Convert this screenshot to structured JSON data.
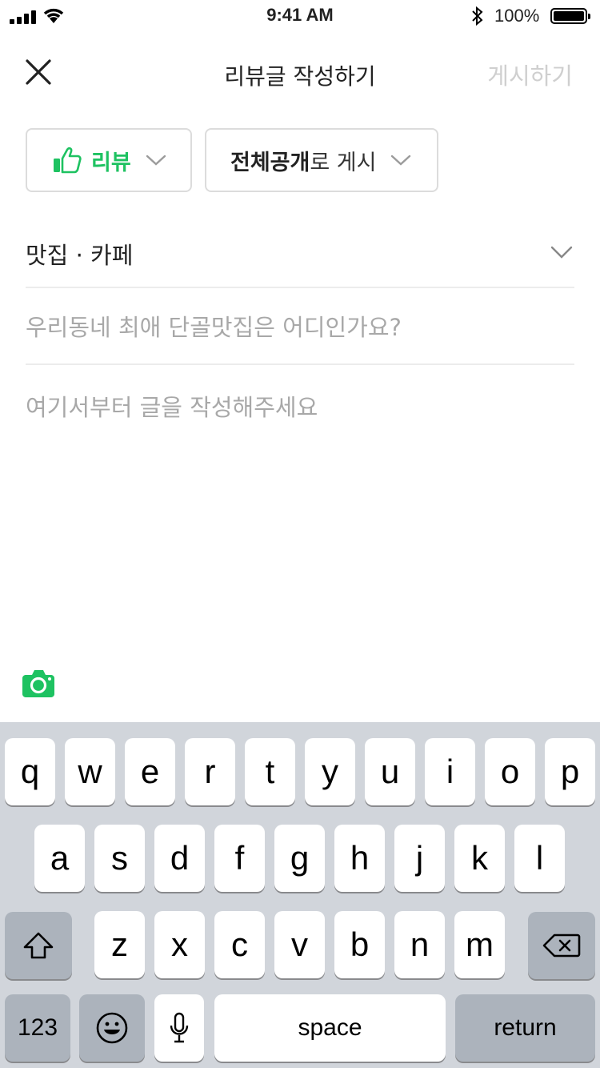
{
  "status_bar": {
    "time": "9:41 AM",
    "battery": "100%"
  },
  "nav": {
    "title": "리뷰글 작성하기",
    "post_label": "게시하기"
  },
  "type_dropdown": {
    "label": "리뷰"
  },
  "visibility_dropdown": {
    "bold": "전체공개",
    "rest": "로 게시"
  },
  "category": {
    "value": "맛집 · 카페"
  },
  "title_field": {
    "placeholder": "우리동네 최애 단골맛집은 어디인가요?"
  },
  "body_field": {
    "placeholder": "여기서부터 글을 작성해주세요"
  },
  "colors": {
    "accent": "#1ec261",
    "keyboard_bg": "#d1d5db",
    "key_dark": "#acb3bc"
  },
  "keyboard": {
    "row1": [
      "q",
      "w",
      "e",
      "r",
      "t",
      "y",
      "u",
      "i",
      "o",
      "p"
    ],
    "row2": [
      "a",
      "s",
      "d",
      "f",
      "g",
      "h",
      "j",
      "k",
      "l"
    ],
    "row3": [
      "z",
      "x",
      "c",
      "v",
      "b",
      "n",
      "m"
    ],
    "numbers_label": "123",
    "space_label": "space",
    "return_label": "return"
  }
}
